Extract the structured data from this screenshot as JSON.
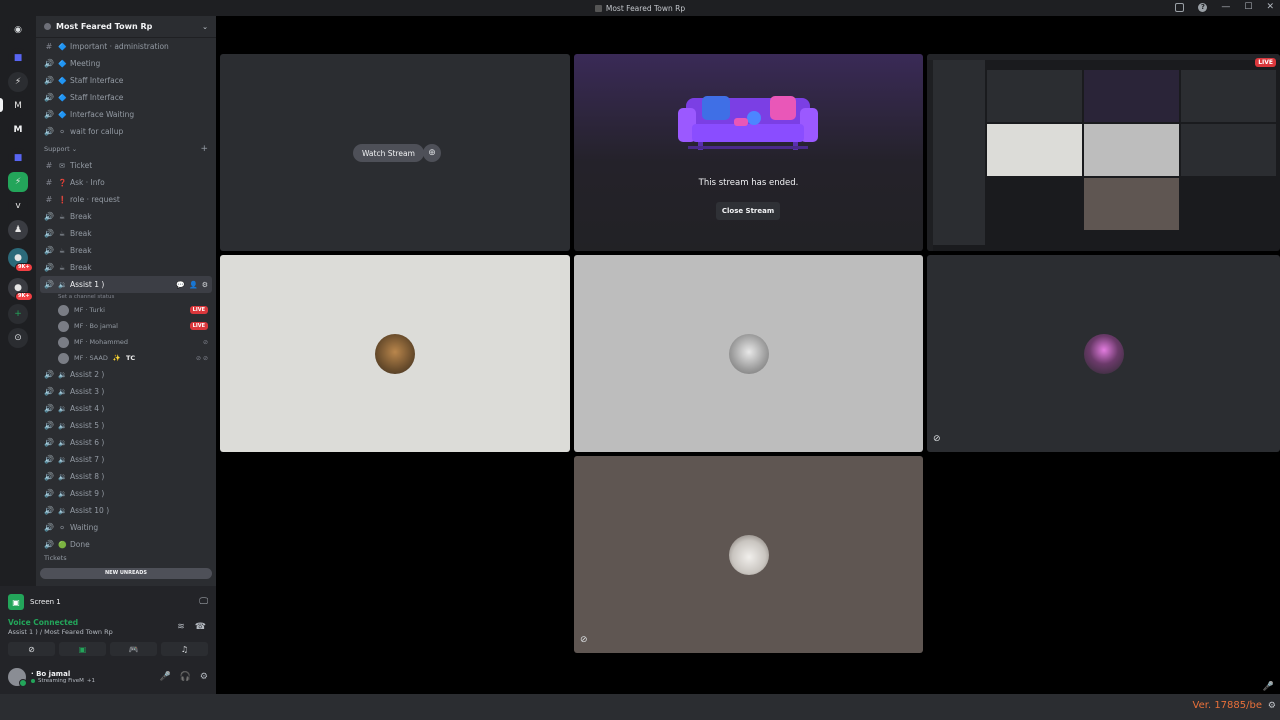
{
  "window": {
    "title": "Most Feared Town Rp"
  },
  "rail": {
    "badges": [
      "9K+",
      "9K+"
    ]
  },
  "sidebar": {
    "server_name": "Most Feared Town Rp",
    "channels_top": [
      {
        "sym": "#",
        "emo": "🔷",
        "label": "Important · administration"
      },
      {
        "sym": "🔊",
        "emo": "🔷",
        "label": "Meeting"
      },
      {
        "sym": "🔊",
        "emo": "🔷",
        "label": "Staff Interface"
      },
      {
        "sym": "🔊",
        "emo": "🔷",
        "label": "Staff Interface"
      },
      {
        "sym": "🔊",
        "emo": "🔷",
        "label": "Interface Waiting"
      },
      {
        "sym": "🔊",
        "emo": "⚪",
        "label": "wait for callup"
      }
    ],
    "category_support": "Support",
    "channels_support": [
      {
        "sym": "#",
        "emo": "✉",
        "label": "Ticket"
      },
      {
        "sym": "#",
        "emo": "❓",
        "label": "Ask · Info"
      },
      {
        "sym": "#",
        "emo": "❗",
        "label": "role · request"
      },
      {
        "sym": "🔊",
        "emo": "☕",
        "label": "Break"
      },
      {
        "sym": "🔊",
        "emo": "☕",
        "label": "Break"
      },
      {
        "sym": "🔊",
        "emo": "☕",
        "label": "Break"
      },
      {
        "sym": "🔊",
        "emo": "☕",
        "label": "Break"
      }
    ],
    "active_channel": {
      "label": "Assist 1 )",
      "status": "Set a channel status"
    },
    "voice_users": [
      {
        "name": "MF · Turki",
        "live": "LIVE"
      },
      {
        "name": "MF · Bo jamal",
        "live": "LIVE"
      },
      {
        "name": "MF · Mohammed",
        "live": ""
      },
      {
        "name": "MF · SAAD",
        "tag": "TC",
        "live": ""
      }
    ],
    "assist_channels": [
      "Assist 2 )",
      "Assist 3 )",
      "Assist 4 )",
      "Assist 5 )",
      "Assist 6 )",
      "Assist 7 )",
      "Assist 8 )",
      "Assist 9 )",
      "Assist 10 )"
    ],
    "channels_bottom": [
      {
        "emo": "⚪",
        "label": "Waiting"
      },
      {
        "emo": "🟢",
        "label": "Done"
      }
    ],
    "new_unreads": "NEW UNREADS",
    "cut_category": "Tickets"
  },
  "panel": {
    "screen_label": "Screen 1",
    "voice_title": "Voice Connected",
    "voice_sub": "Assist 1 ) / Most Feared Town Rp",
    "username": "· Bo jamal",
    "user_status": "Streaming FiveM",
    "user_status_extra": "+1"
  },
  "stage": {
    "watch_label": "Watch Stream",
    "ended_text": "This stream has ended.",
    "close_label": "Close Stream",
    "live_label": "LIVE"
  },
  "footer": {
    "version": "Ver. 17885/be"
  },
  "colors": {
    "accent_green": "#23a55a",
    "live_red": "#da373c",
    "version_orange": "#e8703a"
  }
}
